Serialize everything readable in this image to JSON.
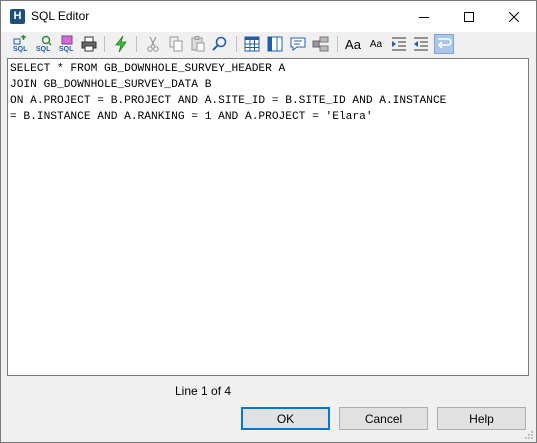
{
  "window": {
    "title": "SQL Editor",
    "app_icon_letter": "H"
  },
  "toolbar": {
    "buttons": [
      {
        "name": "add-sql-icon"
      },
      {
        "name": "query-sql-icon"
      },
      {
        "name": "sql-properties-icon"
      },
      {
        "name": "print-icon"
      },
      {
        "name": "execute-icon"
      },
      {
        "name": "cut-icon"
      },
      {
        "name": "copy-icon"
      },
      {
        "name": "paste-icon"
      },
      {
        "name": "find-icon"
      },
      {
        "name": "table-view-icon"
      },
      {
        "name": "columns-view-icon"
      },
      {
        "name": "comment-icon"
      },
      {
        "name": "schema-icon"
      },
      {
        "name": "font-larger-icon",
        "label": "Aa"
      },
      {
        "name": "font-smaller-icon",
        "label": "Aa"
      },
      {
        "name": "indent-icon"
      },
      {
        "name": "outdent-icon"
      },
      {
        "name": "word-wrap-icon"
      }
    ]
  },
  "editor": {
    "text": "SELECT * FROM GB_DOWNHOLE_SURVEY_HEADER A\nJOIN GB_DOWNHOLE_SURVEY_DATA B\nON A.PROJECT = B.PROJECT AND A.SITE_ID = B.SITE_ID AND A.INSTANCE\n= B.INSTANCE AND A.RANKING = 1 AND A.PROJECT = 'Elara'"
  },
  "status": {
    "line_info": "Line 1 of 4"
  },
  "buttons": {
    "ok": "OK",
    "cancel": "Cancel",
    "help": "Help"
  },
  "colors": {
    "accent": "#0078d7",
    "toolbar_active": "#a9c6e8"
  }
}
